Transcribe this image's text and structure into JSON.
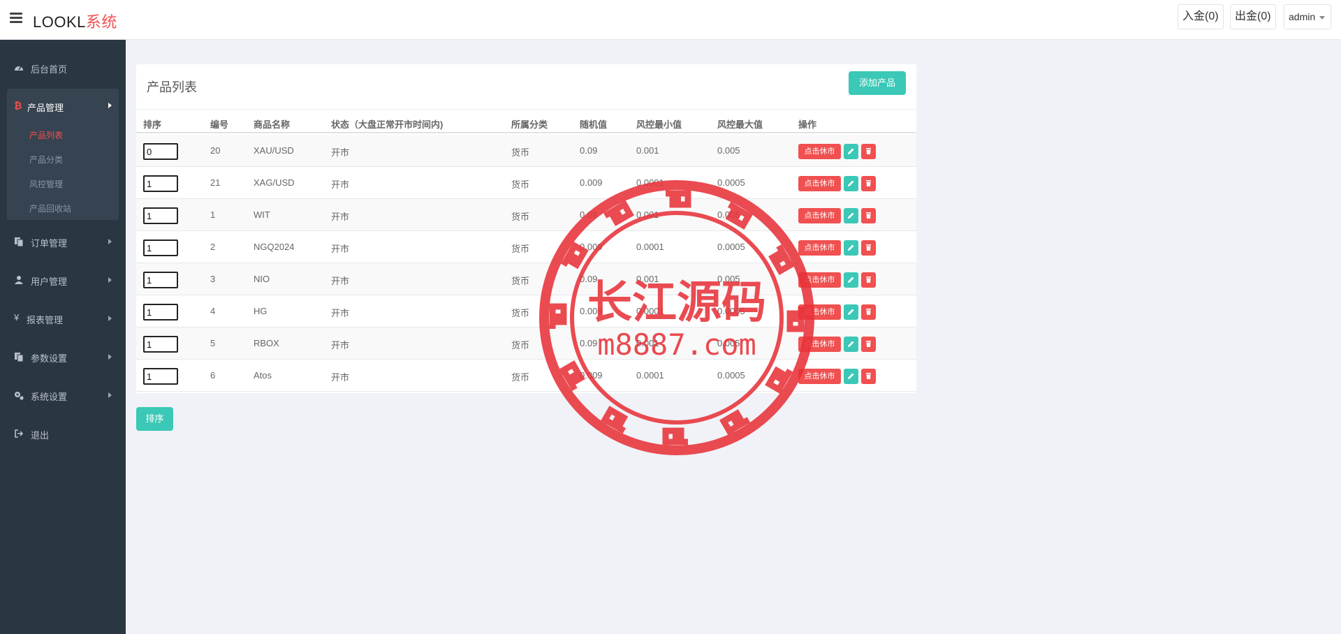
{
  "header": {
    "brand_main": "LOOKL",
    "brand_accent": "系统",
    "deposit_label": "入金(0)",
    "withdraw_label": "出金(0)",
    "user_label": "admin"
  },
  "sidebar": {
    "items": [
      {
        "label": "后台首页",
        "icon": "dashboard-icon"
      },
      {
        "label": "订单管理",
        "icon": "copy-icon"
      },
      {
        "label": "用户管理",
        "icon": "user-icon"
      },
      {
        "label": "报表管理",
        "icon": "yen-icon"
      },
      {
        "label": "参数设置",
        "icon": "copy-icon"
      },
      {
        "label": "系统设置",
        "icon": "cogs-icon"
      },
      {
        "label": "退出",
        "icon": "sign-out-icon"
      }
    ],
    "product_group": {
      "label": "产品管理",
      "icon": "bitcoin-icon",
      "children": [
        {
          "label": "产品列表",
          "active": true
        },
        {
          "label": "产品分类",
          "active": false
        },
        {
          "label": "风控管理",
          "active": false
        },
        {
          "label": "产品回收站",
          "active": false
        }
      ]
    }
  },
  "panel": {
    "title": "产品列表",
    "add_button": "添加产品",
    "columns": [
      "排序",
      "编号",
      "商品名称",
      "状态（大盘正常开市时间内)",
      "所属分类",
      "随机值",
      "风控最小值",
      "风控最大值",
      "操作"
    ],
    "halt_button": "点击休市",
    "rows": [
      {
        "sort": "0",
        "id": "20",
        "name": "XAU/USD",
        "status": "开市",
        "category": "货币",
        "random": "0.09",
        "min": "0.001",
        "max": "0.005"
      },
      {
        "sort": "1",
        "id": "21",
        "name": "XAG/USD",
        "status": "开市",
        "category": "货币",
        "random": "0.009",
        "min": "0.0001",
        "max": "0.0005"
      },
      {
        "sort": "1",
        "id": "1",
        "name": "WIT",
        "status": "开市",
        "category": "货币",
        "random": "0.09",
        "min": "0.001",
        "max": "0.005"
      },
      {
        "sort": "1",
        "id": "2",
        "name": "NGQ2024",
        "status": "开市",
        "category": "货币",
        "random": "0.009",
        "min": "0.0001",
        "max": "0.0005"
      },
      {
        "sort": "1",
        "id": "3",
        "name": "NIO",
        "status": "开市",
        "category": "货币",
        "random": "0.09",
        "min": "0.001",
        "max": "0.005"
      },
      {
        "sort": "1",
        "id": "4",
        "name": "HG",
        "status": "开市",
        "category": "货币",
        "random": "0.009",
        "min": "0.0001",
        "max": "0.0005"
      },
      {
        "sort": "1",
        "id": "5",
        "name": "RBOX",
        "status": "开市",
        "category": "货币",
        "random": "0.09",
        "min": "0.001",
        "max": "0.005"
      },
      {
        "sort": "1",
        "id": "6",
        "name": "Atos",
        "status": "开市",
        "category": "货币",
        "random": "0.009",
        "min": "0.0001",
        "max": "0.0005"
      }
    ],
    "sort_button": "排序"
  },
  "watermark": {
    "line1": "长江源码",
    "line2": "m8887.com",
    "color": "#e8333a"
  },
  "colors": {
    "accent_red": "#f05050",
    "accent_teal": "#3bc8b6",
    "sidebar_bg": "#2b3643"
  }
}
